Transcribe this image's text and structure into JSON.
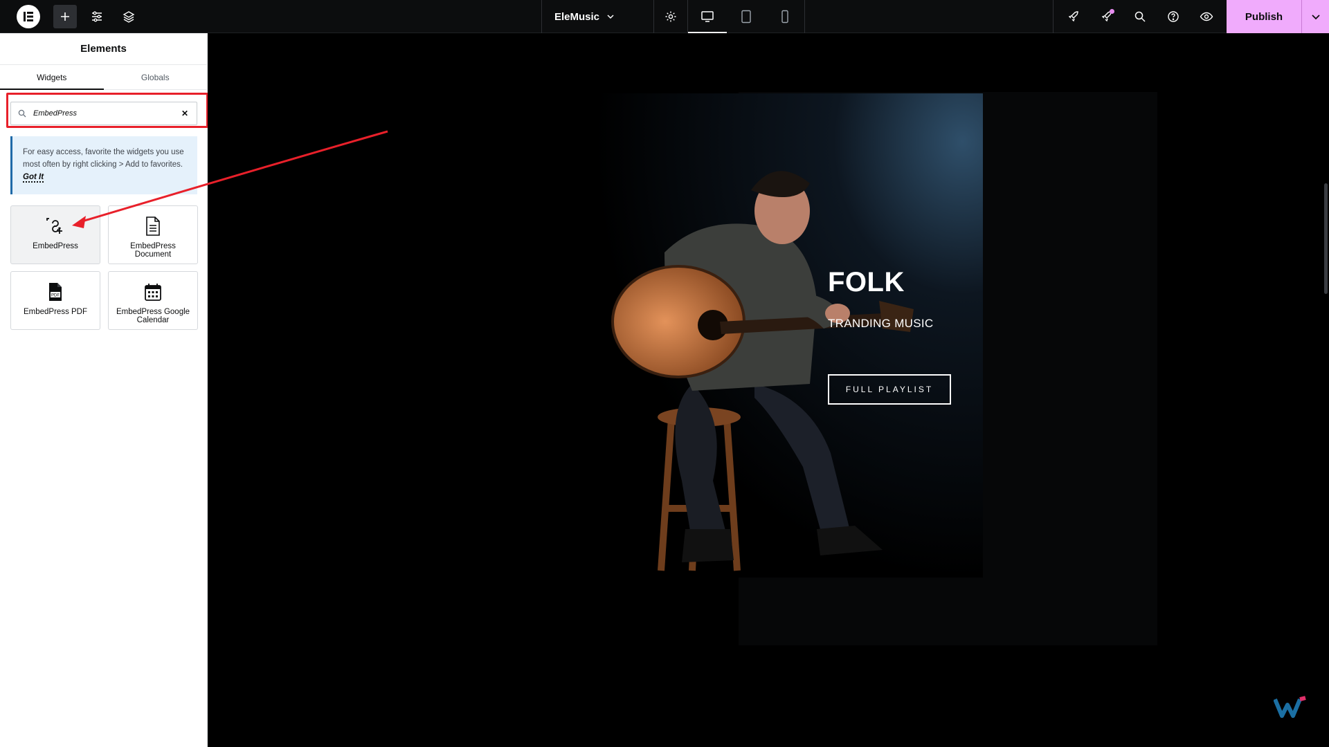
{
  "topbar": {
    "site_name": "EleMusic",
    "publish_label": "Publish"
  },
  "sidebar": {
    "title": "Elements",
    "tabs": [
      "Widgets",
      "Globals"
    ],
    "search": {
      "value": "EmbedPress",
      "placeholder": ""
    },
    "info": {
      "text": "For easy access, favorite the widgets you use most often by right clicking > Add to favorites.",
      "link": "Got It"
    },
    "widgets": [
      {
        "label": "EmbedPress",
        "icon": "embedpress-icon"
      },
      {
        "label": "EmbedPress Document",
        "icon": "document-icon"
      },
      {
        "label": "EmbedPress PDF",
        "icon": "pdf-icon"
      },
      {
        "label": "EmbedPress Google Calendar",
        "icon": "calendar-icon"
      }
    ]
  },
  "canvas": {
    "title": "FOLK",
    "subtitle": "TRANDING MUSIC",
    "button": "FULL PLAYLIST"
  },
  "colors": {
    "publish_bg": "#f0abfc",
    "annotation_red": "#e8202a",
    "info_bg": "#e5f1fb",
    "info_border": "#1f6aa8"
  }
}
